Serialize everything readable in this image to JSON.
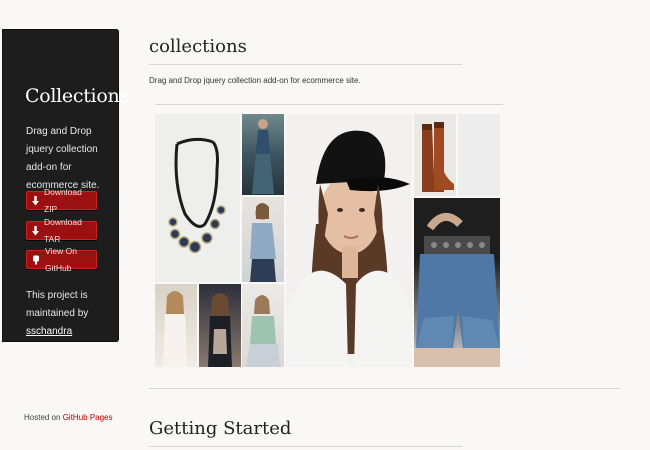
{
  "sidebar": {
    "title": "Collections",
    "tagline": "Drag and Drop jquery collection add-on for ecommerce site.",
    "buttons": {
      "download_zip": "Download ZIP",
      "download_tar": "Download TAR",
      "view_github": "View On GitHub"
    },
    "maintained_prefix": "This project is maintained by",
    "maintainer": "sschandra",
    "hosted_prefix": "Hosted on",
    "hosted_link": "GitHub Pages"
  },
  "main": {
    "title": "collections",
    "description": "Drag and Drop jquery collection add-on for ecommerce site.",
    "section_heading": "Getting Started"
  },
  "gallery": {
    "items": [
      "necklace-image",
      "maxi-dress-image",
      "denim-shirt-image",
      "white-top-image",
      "dark-outfit-image",
      "green-top-image",
      "model-black-cap-image",
      "brown-boots-image",
      "blank-tile",
      "denim-shorts-image"
    ]
  },
  "colors": {
    "sidebar_bg": "#1d1d1d",
    "button_bg": "#9b1010",
    "page_bg": "#f9f8f6",
    "link_red": "#bb0000"
  }
}
